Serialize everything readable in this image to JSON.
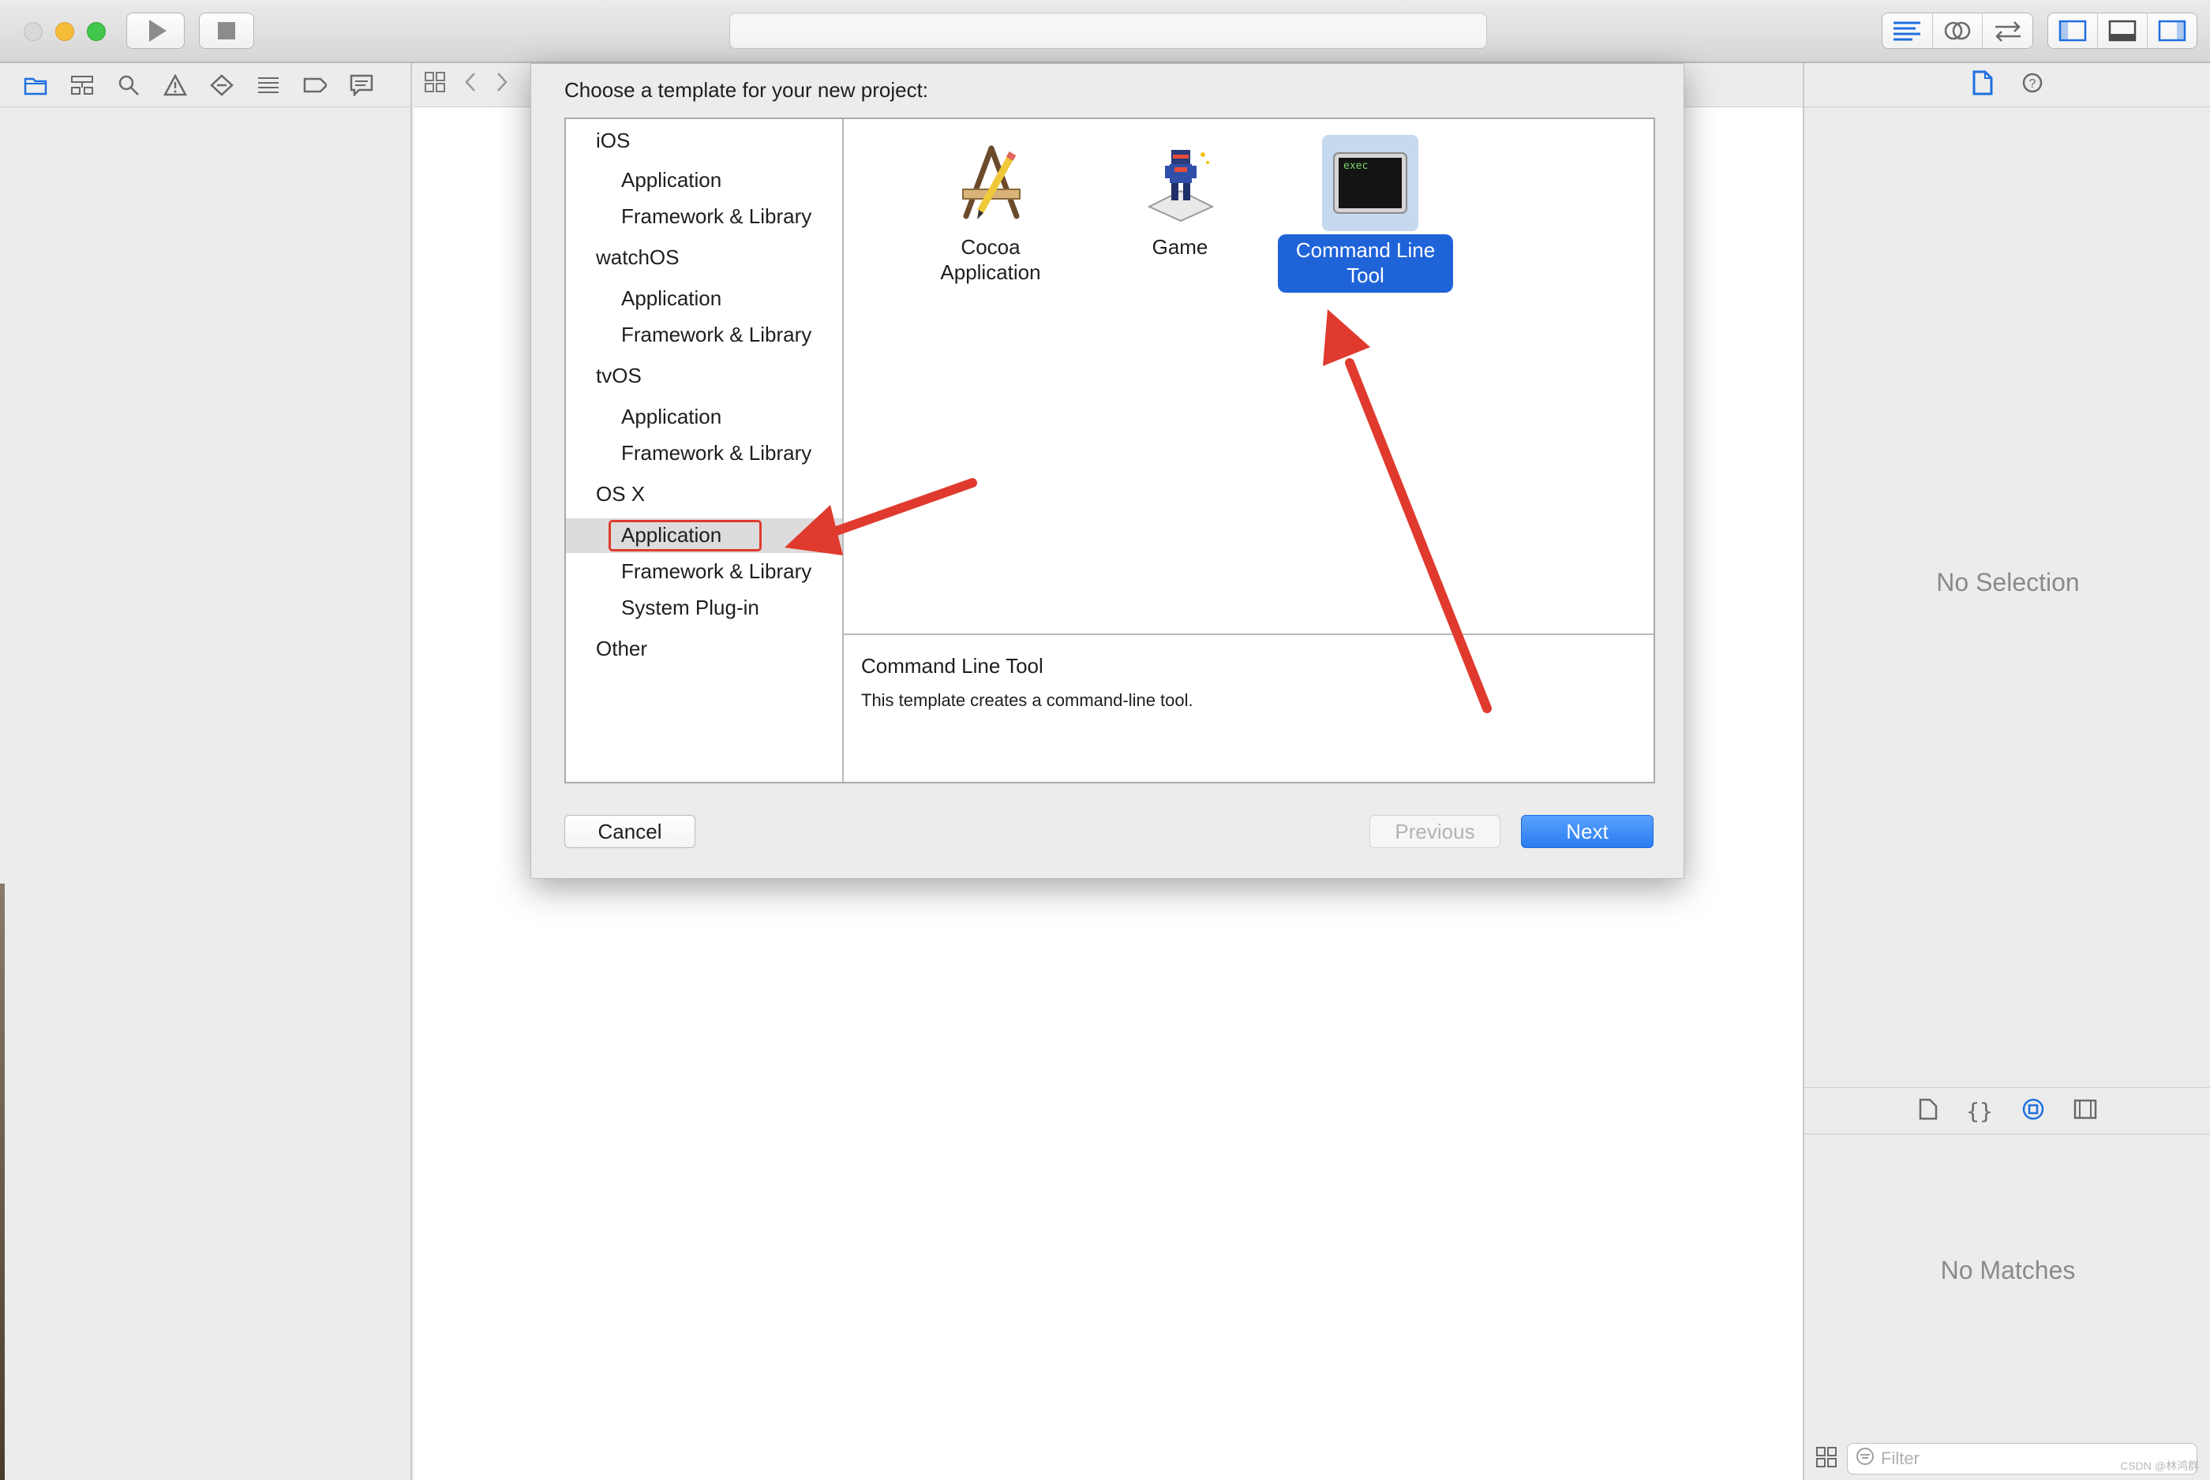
{
  "toolbar": {
    "run_icon": "play-icon",
    "stop_icon": "stop-icon",
    "editor_modes": [
      "standard-editor-icon",
      "assistant-editor-icon",
      "version-editor-icon"
    ],
    "view_toggles": [
      "navigator-toggle-icon",
      "debug-area-toggle-icon",
      "utilities-toggle-icon"
    ]
  },
  "navigator": {
    "tabs": [
      "folder-icon",
      "hierarchy-icon",
      "search-icon",
      "warning-icon",
      "test-icon",
      "debug-icon",
      "breakpoint-icon",
      "report-icon"
    ]
  },
  "dialog": {
    "title": "Choose a template for your new project:",
    "categories": [
      {
        "label": "iOS",
        "items": [
          "Application",
          "Framework & Library"
        ]
      },
      {
        "label": "watchOS",
        "items": [
          "Application",
          "Framework & Library"
        ]
      },
      {
        "label": "tvOS",
        "items": [
          "Application",
          "Framework & Library"
        ]
      },
      {
        "label": "OS X",
        "items": [
          "Application",
          "Framework & Library",
          "System Plug-in"
        ]
      },
      {
        "label": "Other",
        "items": []
      }
    ],
    "selected_category": "OS X / Application",
    "templates": [
      {
        "label": "Cocoa\nApplication",
        "icon": "cocoa-app-icon"
      },
      {
        "label": "Game",
        "icon": "game-icon"
      },
      {
        "label": "Command Line\nTool",
        "icon": "terminal-icon",
        "icon_text": "exec",
        "selected": true
      }
    ],
    "description": {
      "title": "Command Line Tool",
      "text": "This template creates a command-line tool."
    },
    "buttons": {
      "cancel": "Cancel",
      "previous": "Previous",
      "next": "Next"
    }
  },
  "inspector": {
    "no_selection": "No Selection",
    "no_matches": "No Matches",
    "filter_placeholder": "Filter",
    "watermark": "CSDN @林鸿群"
  },
  "colors": {
    "accent": "#1f6fe0",
    "annotation": "#e03a2e",
    "selection": "#1f63d8"
  }
}
